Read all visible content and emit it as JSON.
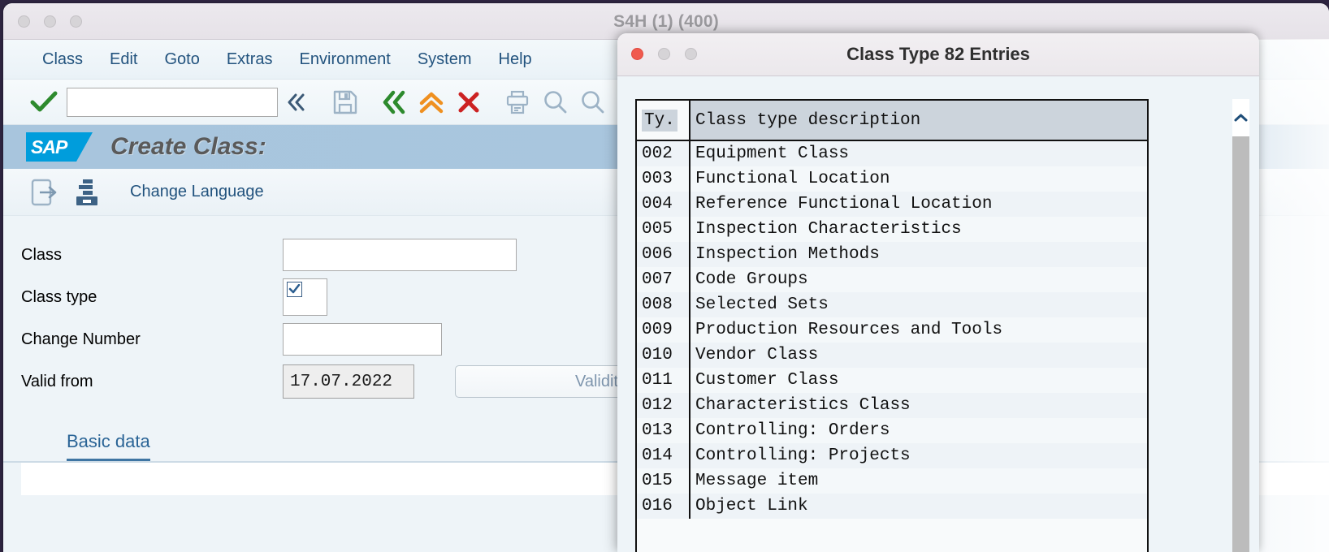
{
  "main_window": {
    "title": "S4H (1) (400)",
    "traffic_lights": [
      "close",
      "minimize",
      "zoom"
    ],
    "menubar": [
      "Class",
      "Edit",
      "Goto",
      "Extras",
      "Environment",
      "System",
      "Help"
    ],
    "toolbar": {
      "command_field_value": "",
      "command_field_placeholder": "",
      "icons": [
        "enter-check-icon",
        "back-chevrons-icon",
        "save-disk-icon",
        "back-green-icon",
        "exit-orange-icon",
        "cancel-red-icon",
        "print-icon",
        "find-icon",
        "find-next-icon"
      ]
    },
    "header": {
      "logo": "sap-logo",
      "logo_text": "SAP",
      "page_title": "Create Class:"
    },
    "subtoolbar": {
      "icons": [
        "other-class-icon",
        "change-language-icon"
      ],
      "link_label": "Change Language"
    },
    "form": {
      "rows": [
        {
          "label": "Class",
          "value": "",
          "control": "text"
        },
        {
          "label": "Class type",
          "value": "",
          "control": "checkbox-box"
        },
        {
          "label": "Change Number",
          "value": "",
          "control": "text"
        },
        {
          "label": "Valid from",
          "value": "17.07.2022",
          "control": "date"
        }
      ],
      "validity_button_label": "Validity"
    },
    "tabs": [
      {
        "label": "Basic data",
        "active": true
      }
    ]
  },
  "dialog": {
    "title": "Class Type 82 Entries",
    "traffic_lights": [
      "close",
      "minimize",
      "zoom"
    ],
    "table": {
      "columns": [
        "Ty.",
        "Class type description"
      ],
      "rows": [
        {
          "ty": "002",
          "desc": "Equipment Class"
        },
        {
          "ty": "003",
          "desc": "Functional Location"
        },
        {
          "ty": "004",
          "desc": "Reference Functional Location"
        },
        {
          "ty": "005",
          "desc": "Inspection Characteristics"
        },
        {
          "ty": "006",
          "desc": "Inspection Methods"
        },
        {
          "ty": "007",
          "desc": "Code Groups"
        },
        {
          "ty": "008",
          "desc": "Selected Sets"
        },
        {
          "ty": "009",
          "desc": "Production Resources and Tools"
        },
        {
          "ty": "010",
          "desc": "Vendor Class"
        },
        {
          "ty": "011",
          "desc": "Customer Class"
        },
        {
          "ty": "012",
          "desc": "Characteristics Class"
        },
        {
          "ty": "013",
          "desc": "Controlling: Orders"
        },
        {
          "ty": "014",
          "desc": "Controlling: Projects"
        },
        {
          "ty": "015",
          "desc": "Message item"
        },
        {
          "ty": "016",
          "desc": "Object Link"
        }
      ]
    },
    "scrollbar": {
      "up_arrow_icon": "chevron-up-icon"
    }
  },
  "colors": {
    "sap_blue": "#009ddc",
    "header_band": "#a8c5dd",
    "link_blue": "#22537e",
    "tab_active": "#3f75a3",
    "green_check": "#2d8a2d",
    "orange": "#ef9020",
    "red": "#cc2222",
    "close_red": "#f05a4e"
  }
}
